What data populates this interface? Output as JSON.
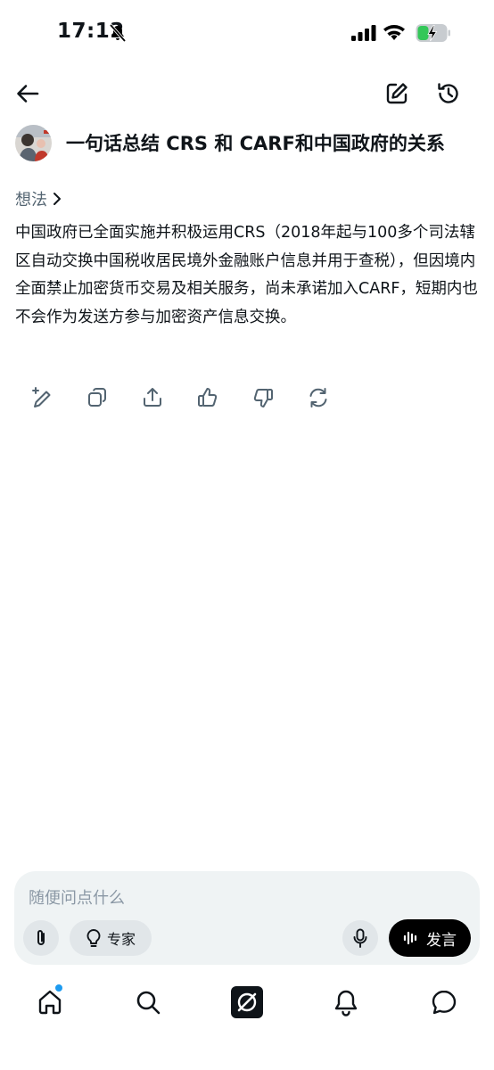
{
  "status_bar": {
    "time": "17:12",
    "icons": [
      "bell-off-icon",
      "cellular-signal-icon",
      "wifi-icon",
      "battery-charging-icon"
    ],
    "battery_color": "#34c759"
  },
  "header": {
    "icons": [
      "back-arrow-icon",
      "new-chat-edit-icon",
      "history-icon"
    ]
  },
  "chat": {
    "title": "一句话总结 CRS 和 CARF和中国政府的关系",
    "thoughts_label": "想法",
    "answer": "中国政府已全面实施并积极运用CRS（2018年起与100多个司法辖区自动交换中国税收居民境外金融账户信息并用于查税），但因境内全面禁止加密货币交易及相关服务，尚未承诺加入CARF，短期内也不会作为发送方参与加密资产信息交换。",
    "actions": [
      "edit-sparkle-icon",
      "copy-icon",
      "share-icon",
      "thumbs-up-icon",
      "thumbs-down-icon",
      "regenerate-icon"
    ]
  },
  "composer": {
    "placeholder": "随便问点什么",
    "expert_label": "专家",
    "speak_label": "发言",
    "icons": [
      "paperclip-icon",
      "lightbulb-icon",
      "microphone-icon",
      "voice-waveform-icon"
    ]
  },
  "bottom_nav": {
    "items": [
      "home-icon",
      "search-icon",
      "grok-icon",
      "notifications-icon",
      "messages-icon"
    ],
    "notification_dot_color": "#1d9bf0"
  }
}
